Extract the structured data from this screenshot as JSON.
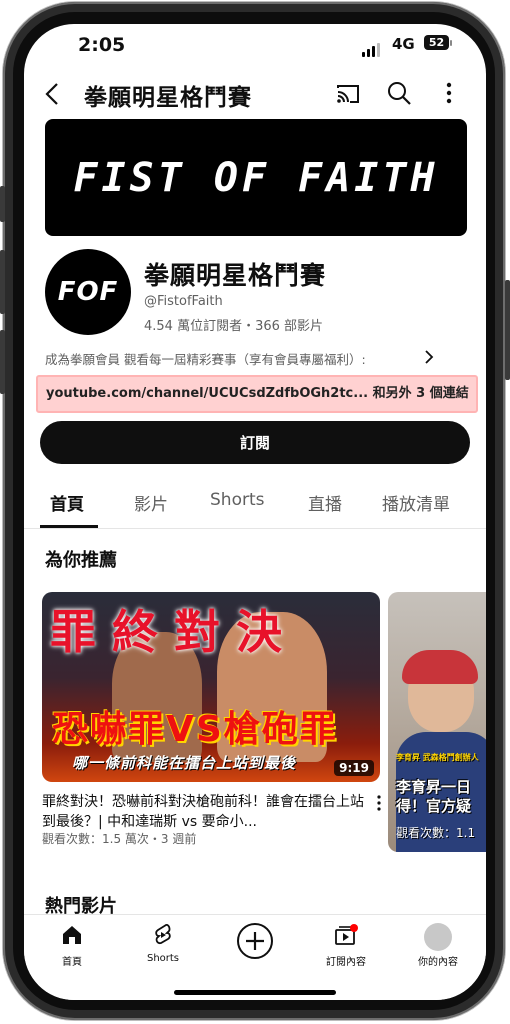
{
  "status": {
    "time": "2:05",
    "network": "4G",
    "battery": "52"
  },
  "topbar": {
    "title": "拳願明星格鬥賽"
  },
  "banner": {
    "text": "FIST OF FAITH"
  },
  "channel": {
    "avatar_text": "FOF",
    "name": "拳願明星格鬥賽",
    "handle": "@FistofFaith",
    "stats": "4.54 萬位訂閱者・366 部影片",
    "description": "成為拳願會員 觀看每一屆精彩賽事（享有會員專屬福利）:",
    "link": "youtube.com/channel/UCUCsdZdfbOGh2tc...",
    "link_more": "和另外 3 個連結",
    "subscribe_label": "訂閱"
  },
  "tabs": [
    "首頁",
    "影片",
    "Shorts",
    "直播",
    "播放清單"
  ],
  "sections": {
    "recommended": "為你推薦",
    "popular": "熱門影片"
  },
  "videos": [
    {
      "thumb_top": "罪終對決",
      "thumb_vs": "恐嚇罪VS槍砲罪",
      "thumb_sub": "哪一條前科能在擂台上站到最後",
      "duration": "9:19",
      "title": "罪終對決！恐嚇前科對決槍砲前科！誰會在擂台上站到最後？| 中和達瑞斯 vs 要命小...",
      "meta": "觀看次數：1.5 萬次・3 週前"
    },
    {
      "thumb_tag": "李育昇 武森格鬥創辦人",
      "thumb_caption1": "李育昇一日",
      "thumb_caption2": "得！官方疑",
      "views": "觀看次數：1.1"
    }
  ],
  "bottom_nav": {
    "home": "首頁",
    "shorts": "Shorts",
    "subscriptions": "訂閱內容",
    "you": "你的內容"
  },
  "colors": {
    "link_highlight": "#ffd1d1",
    "subscribe_bg": "#0f0f0f",
    "notification_dot": "#ff0000"
  }
}
